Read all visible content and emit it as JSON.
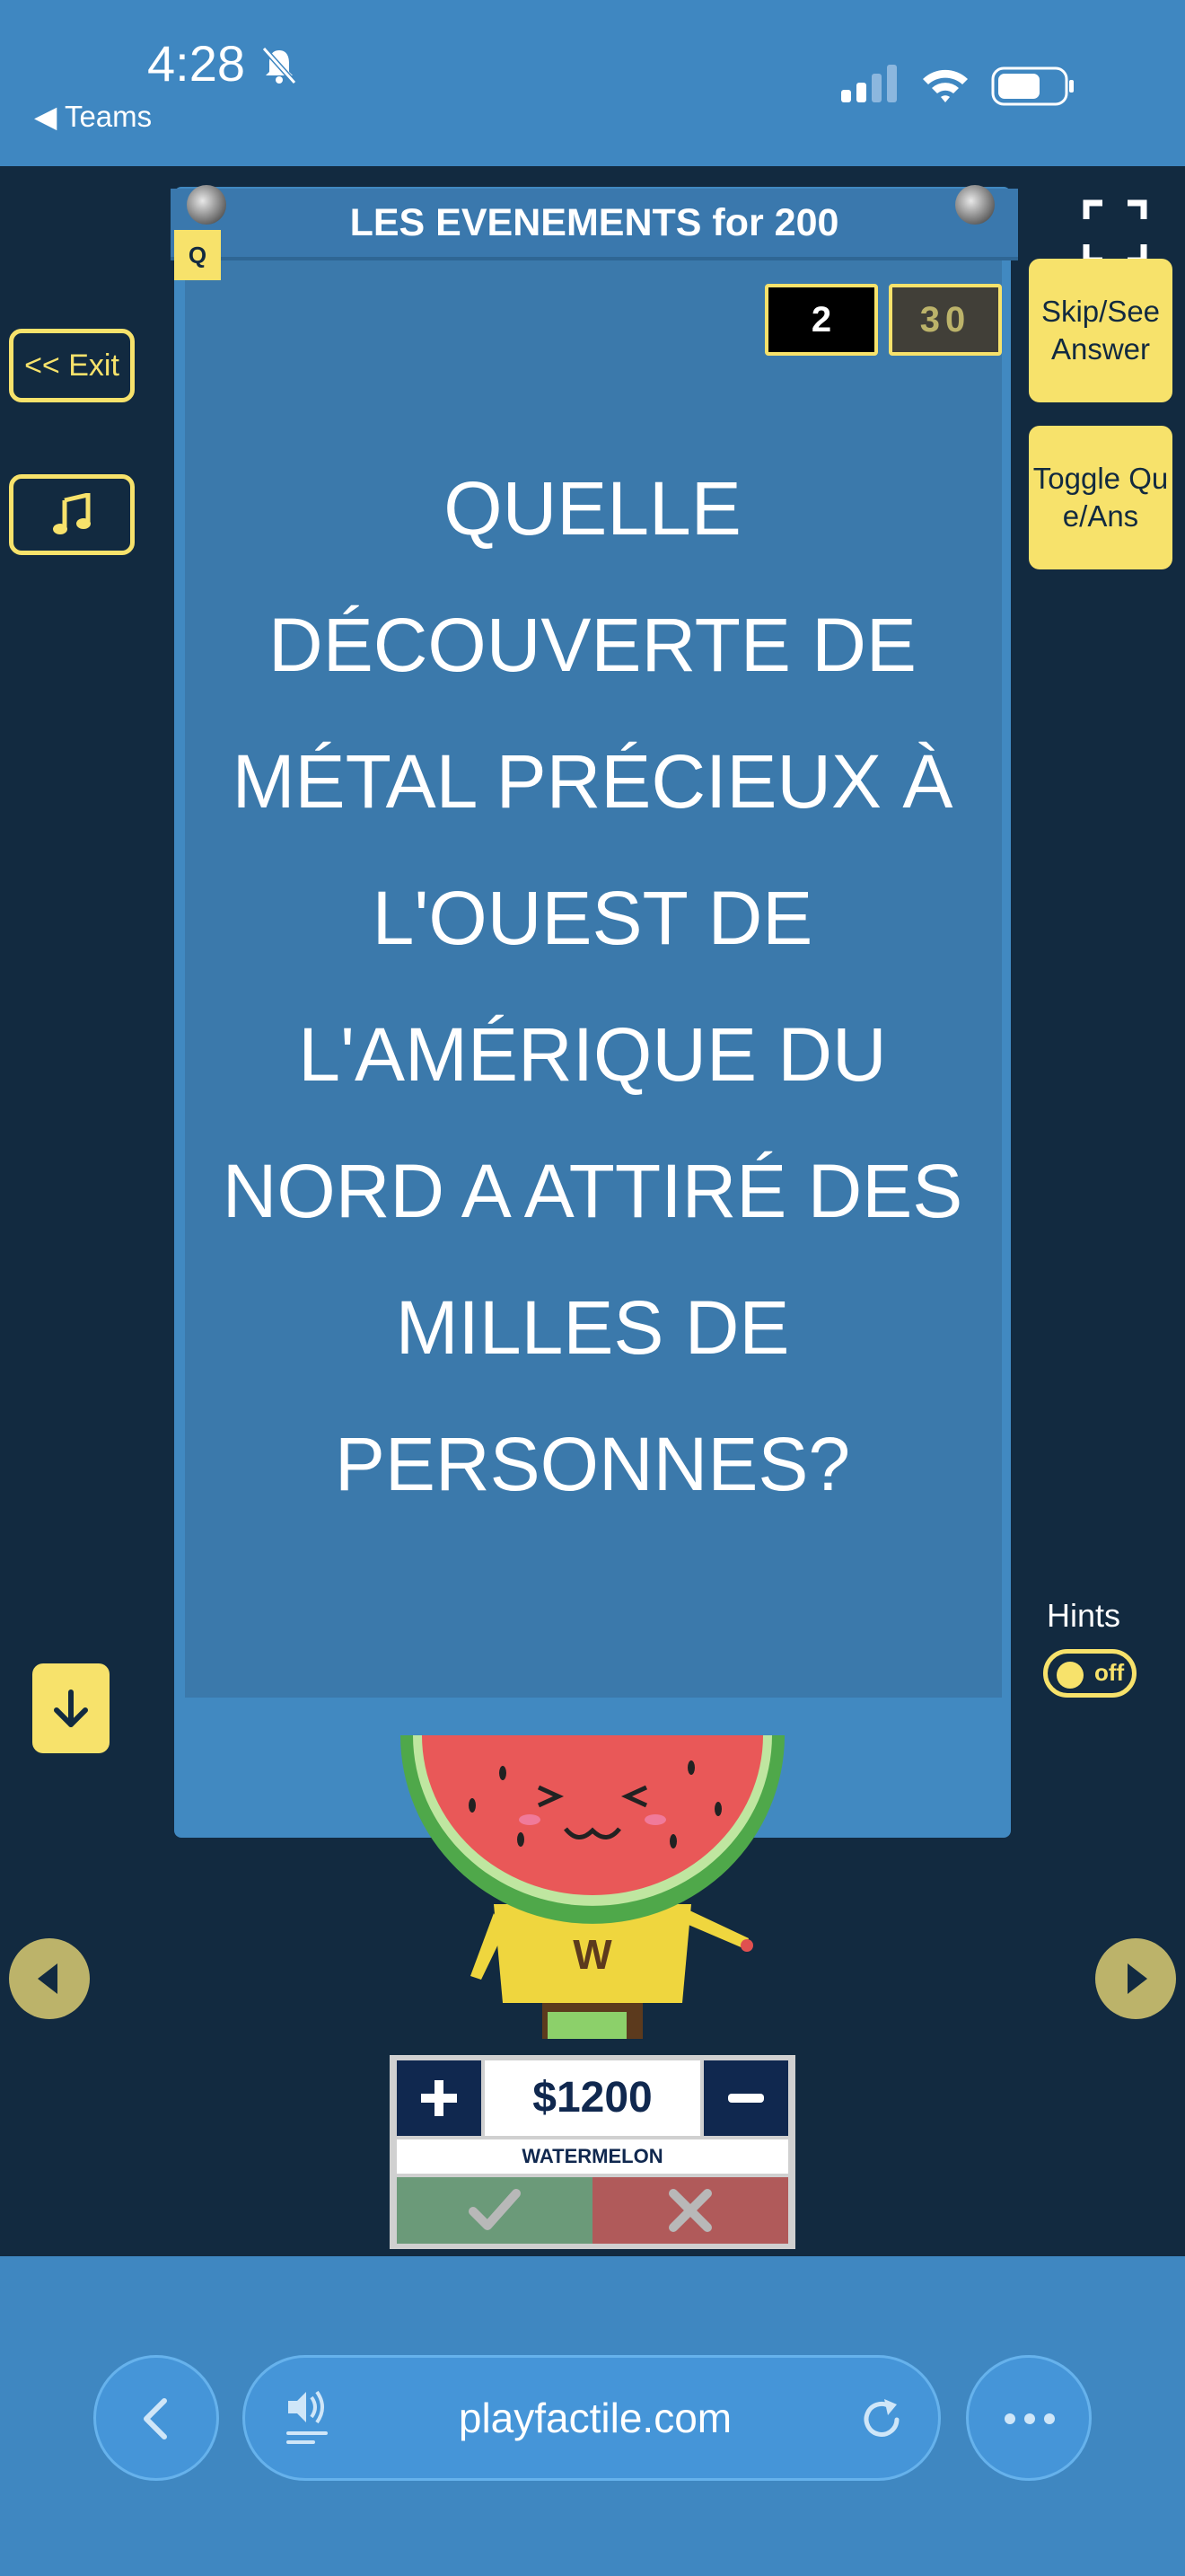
{
  "status_bar": {
    "time": "4:28",
    "back_app_label": "◀ Teams"
  },
  "game": {
    "category_title": "LES EVENEMENTS for 200",
    "question_badge": "Q",
    "score_box_a": "2",
    "score_box_b": "30",
    "question_text": "QUELLE DÉCOUVERTE DE MÉTAL PRÉCIEUX À L'OUEST DE L'AMÉRIQUE DU NORD A ATTIRÉ DES MILLES DE PERSONNES?"
  },
  "left_controls": {
    "exit_label": "<< Exit"
  },
  "right_controls": {
    "skip_label": "Skip/See Answer",
    "toggle_label": "Toggle Que/Ans",
    "hints_label": "Hints",
    "hints_state": "off"
  },
  "team": {
    "mascot_letter": "W",
    "score": "$1200",
    "name": "WATERMELON"
  },
  "browser": {
    "url": "playfactile.com"
  },
  "colors": {
    "accent_yellow": "#f7e26b",
    "background_navy": "#122a40",
    "card_blue": "#4189c1",
    "browser_blue": "#3f87c1"
  },
  "icons": [
    "bell-slash-icon",
    "signal-icon",
    "wifi-icon",
    "battery-icon",
    "music-note-icon",
    "fullscreen-icon",
    "arrow-down-icon",
    "chevron-left-icon",
    "chevron-right-icon",
    "plus-icon",
    "minus-icon",
    "check-icon",
    "x-icon",
    "sound-icon",
    "reload-icon",
    "more-icon"
  ]
}
